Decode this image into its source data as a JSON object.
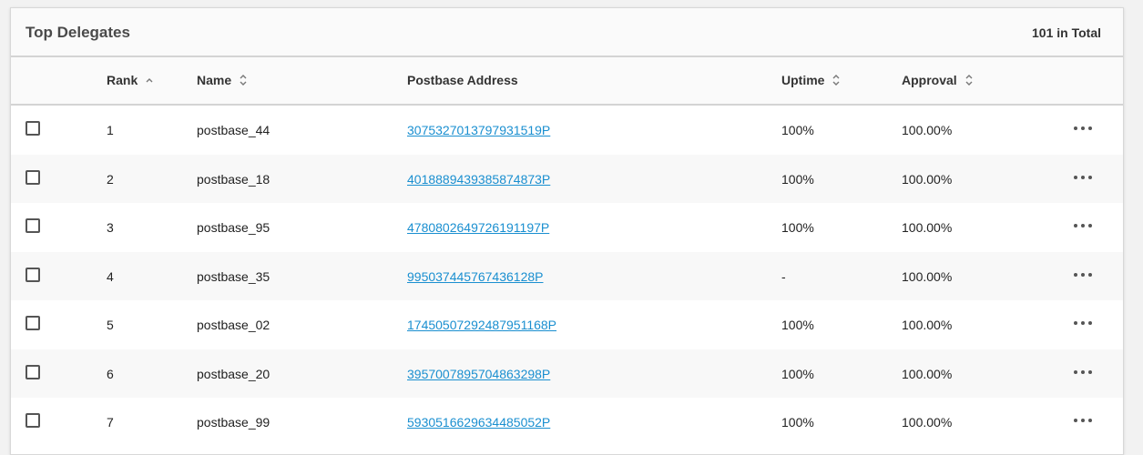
{
  "header": {
    "title": "Top Delegates",
    "total": "101 in Total"
  },
  "columns": {
    "rank": "Rank",
    "name": "Name",
    "address": "Postbase Address",
    "uptime": "Uptime",
    "approval": "Approval"
  },
  "icons": {
    "rank_sort": "chevron-up-icon",
    "other_sort": "sort-updown-icon",
    "row_menu": "more-horizontal-icon",
    "row_select": "checkbox-icon"
  },
  "colors": {
    "link": "#1a8fd0",
    "header_bg": "#fafafa",
    "stripe": "#f8f8f8"
  },
  "rows": [
    {
      "rank": "1",
      "name": "postbase_44",
      "address": "3075327013797931519P",
      "uptime": "100%",
      "approval": "100.00%"
    },
    {
      "rank": "2",
      "name": "postbase_18",
      "address": "4018889439385874873P",
      "uptime": "100%",
      "approval": "100.00%"
    },
    {
      "rank": "3",
      "name": "postbase_95",
      "address": "4780802649726191197P",
      "uptime": "100%",
      "approval": "100.00%"
    },
    {
      "rank": "4",
      "name": "postbase_35",
      "address": "995037445767436128P",
      "uptime": "-",
      "approval": "100.00%"
    },
    {
      "rank": "5",
      "name": "postbase_02",
      "address": "17450507292487951168P",
      "uptime": "100%",
      "approval": "100.00%"
    },
    {
      "rank": "6",
      "name": "postbase_20",
      "address": "3957007895704863298P",
      "uptime": "100%",
      "approval": "100.00%"
    },
    {
      "rank": "7",
      "name": "postbase_99",
      "address": "5930516629634485052P",
      "uptime": "100%",
      "approval": "100.00%"
    }
  ]
}
